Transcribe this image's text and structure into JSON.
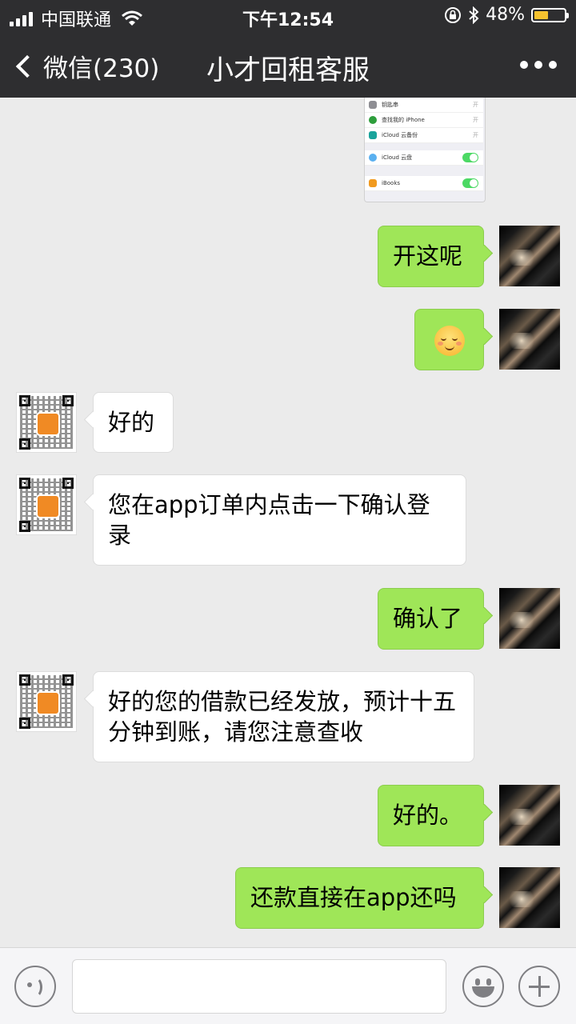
{
  "status_bar": {
    "carrier": "中国联通",
    "time": "下午12:54",
    "battery_percent": "48%",
    "battery_level": 0.48,
    "icons": [
      "signal-icon",
      "wifi-icon",
      "orientation-lock-icon",
      "bluetooth-icon",
      "battery-icon"
    ]
  },
  "nav": {
    "back_label": "微信(230)",
    "title": "小才回租客服"
  },
  "screenshot_card": {
    "rows": [
      {
        "label": "钥匙串",
        "value": "开"
      },
      {
        "label": "查找我的 iPhone",
        "value": "开"
      },
      {
        "label": "iCloud 云备份",
        "value": "开"
      },
      {
        "label": "iCloud 云盘",
        "value": ""
      },
      {
        "label": "iBooks",
        "value": ""
      }
    ]
  },
  "messages": [
    {
      "side": "out",
      "text": "开这呢"
    },
    {
      "side": "out",
      "type": "emoji",
      "emoji": "shy-smile-emoji"
    },
    {
      "side": "in",
      "text": "好的"
    },
    {
      "side": "in",
      "text": "您在app订单内点击一下确认登录"
    },
    {
      "side": "out",
      "text": "确认了"
    },
    {
      "side": "in",
      "text": "好的您的借款已经发放，预计十五分钟到账，请您注意查收"
    },
    {
      "side": "out",
      "text": "好的。"
    },
    {
      "side": "out",
      "text": "还款直接在app还吗"
    }
  ],
  "input_bar": {
    "value": "",
    "icons": [
      "voice-icon",
      "emoji-icon",
      "plus-icon"
    ]
  },
  "colors": {
    "bar_bg": "#2e2e30",
    "chat_bg": "#ebebeb",
    "outgoing_bubble": "#9fe658",
    "incoming_bubble": "#ffffff",
    "battery": "#f6c22f"
  }
}
